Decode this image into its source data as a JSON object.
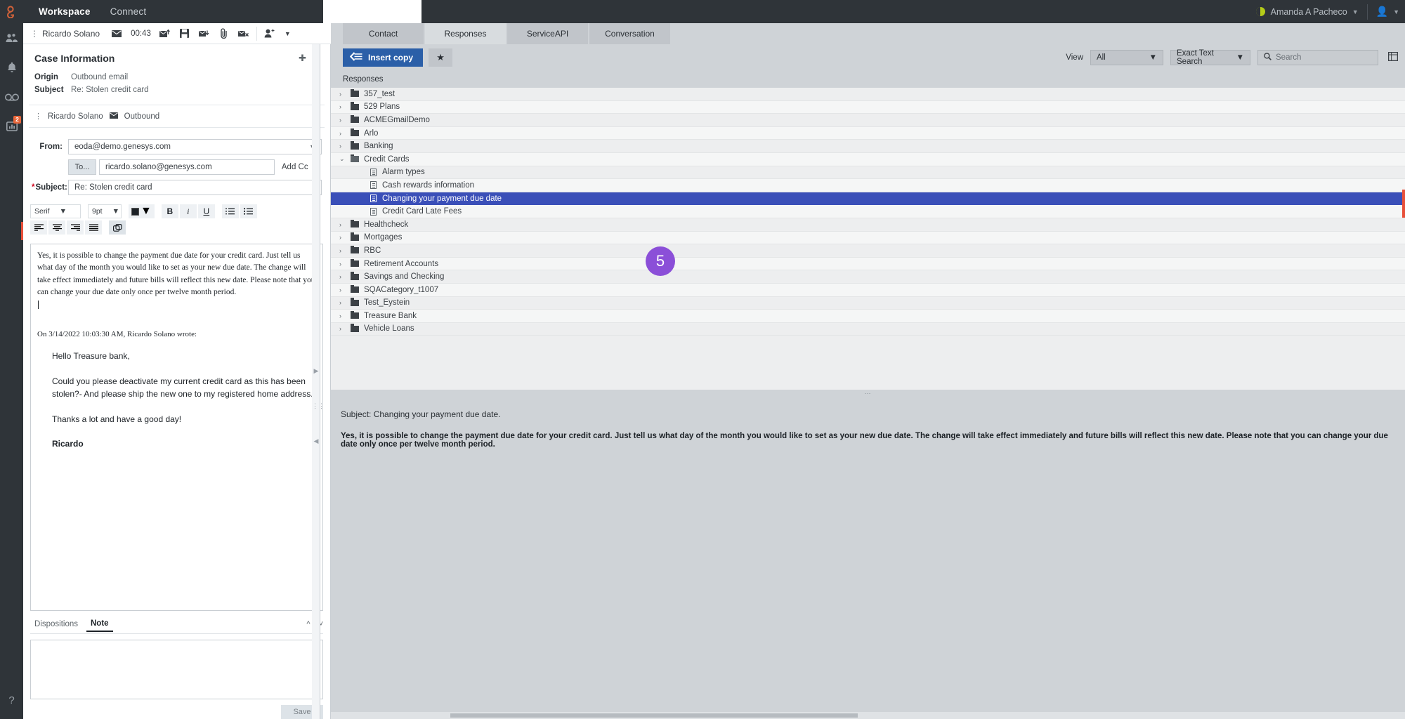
{
  "topbar": {
    "logo": "genesys-logo",
    "nav": [
      {
        "label": "Workspace",
        "active": true
      },
      {
        "label": "Connect",
        "active": false
      }
    ],
    "user_name": "Amanda A Pacheco",
    "status_icon": "half-circle-status-icon",
    "status_color": "#b5cc18",
    "agent_icon": "person-icon"
  },
  "rail": {
    "items": [
      {
        "name": "contacts-icon"
      },
      {
        "name": "notifications-bell-icon"
      },
      {
        "name": "voicemail-icon"
      },
      {
        "name": "dashboard-icon",
        "badge": "2"
      }
    ],
    "help_label": "?"
  },
  "case_toolbar": {
    "party": "Ricardo Solano",
    "timer": "00:43",
    "icons": [
      "email-icon",
      "reply-send-icon",
      "save-icon",
      "transfer-icon",
      "attachment-icon",
      "delete-email-icon",
      "consult-person-icon"
    ]
  },
  "case_info": {
    "title": "Case Information",
    "add_icon": "plus-icon",
    "collapse_icon": "chevron-up-icon",
    "fields": [
      {
        "key": "Origin",
        "value": "Outbound email"
      },
      {
        "key": "Subject",
        "value": "Re: Stolen credit card"
      }
    ],
    "party_row": {
      "name": "Ricardo Solano",
      "direction": "Outbound",
      "icon": "email-icon"
    }
  },
  "compose": {
    "from_label": "From:",
    "from_value": "eoda@demo.genesys.com",
    "to_label": "To...",
    "to_value": "ricardo.solano@genesys.com",
    "add_cc_label": "Add Cc",
    "subject_label": "Subject:",
    "subject_value": "Re: Stolen credit card",
    "toolbar": {
      "font_family": "Serif",
      "font_size": "9pt",
      "bold": "B",
      "italic": "i",
      "underline": "U",
      "color_icon": "text-color-icon",
      "ordered_list_icon": "numbered-list-icon",
      "unordered_list_icon": "bullet-list-icon",
      "align_left_icon": "align-left-icon",
      "align_center_icon": "align-center-icon",
      "align_right_icon": "align-right-icon",
      "align_justify_icon": "align-justify-icon",
      "insert_image_icon": "insert-image-icon"
    },
    "reply_text": "Yes, it is possible to change the payment due date for your credit card.  Just tell us what day of the month you would like to set as your new due date.  The change will take effect immediately and future bills will reflect this new date.  Please note that you can change your due date only once per twelve month period.",
    "quote_header": "On 3/14/2022 10:03:30 AM, Ricardo Solano wrote:",
    "quoted": [
      "Hello Treasure bank,",
      "Could you please deactivate my current credit card as this has been stolen?- And please ship the new one to my registered home address.",
      "Thanks a lot and have a good day!"
    ],
    "quoted_signature": "Ricardo"
  },
  "bottom_tabs": {
    "tabs": [
      {
        "label": "Dispositions",
        "active": false
      },
      {
        "label": "Note",
        "active": true
      }
    ],
    "collapse_up_icon": "chevron-up-icon",
    "collapse_down_icon": "chevron-down-icon",
    "note_value": "",
    "save_label": "Save"
  },
  "right": {
    "tabs": [
      {
        "label": "Contact",
        "active": false
      },
      {
        "label": "Responses",
        "active": true
      },
      {
        "label": "ServiceAPI",
        "active": false
      },
      {
        "label": "Conversation",
        "active": false
      }
    ],
    "insert_copy_label": "Insert copy",
    "insert_copy_icon": "insert-arrow-icon",
    "favorite_icon": "star-add-icon",
    "view_label": "View",
    "view_value": "All",
    "search_mode_value": "Exact Text Search",
    "search_placeholder": "Search",
    "search_icon": "search-icon",
    "grid_icon": "grid-view-icon",
    "responses_label": "Responses",
    "step_badge": "5",
    "tree": [
      {
        "label": "357_test",
        "type": "folder",
        "level": 1,
        "expanded": false
      },
      {
        "label": "529 Plans",
        "type": "folder",
        "level": 1,
        "expanded": false
      },
      {
        "label": "ACMEGmailDemo",
        "type": "folder",
        "level": 1,
        "expanded": false
      },
      {
        "label": "Arlo",
        "type": "folder",
        "level": 1,
        "expanded": false
      },
      {
        "label": "Banking",
        "type": "folder",
        "level": 1,
        "expanded": false
      },
      {
        "label": "Credit Cards",
        "type": "folder",
        "level": 1,
        "expanded": true
      },
      {
        "label": "Alarm types",
        "type": "document",
        "level": 2
      },
      {
        "label": "Cash rewards information",
        "type": "document",
        "level": 2
      },
      {
        "label": "Changing your payment due date",
        "type": "document",
        "level": 2,
        "selected": true
      },
      {
        "label": "Credit Card Late Fees",
        "type": "document",
        "level": 2
      },
      {
        "label": "Healthcheck",
        "type": "folder",
        "level": 1,
        "expanded": false
      },
      {
        "label": "Mortgages",
        "type": "folder",
        "level": 1,
        "expanded": false
      },
      {
        "label": "RBC",
        "type": "folder",
        "level": 1,
        "expanded": false
      },
      {
        "label": "Retirement Accounts",
        "type": "folder",
        "level": 1,
        "expanded": false
      },
      {
        "label": "Savings and Checking",
        "type": "folder",
        "level": 1,
        "expanded": false
      },
      {
        "label": "SQACategory_t1007",
        "type": "folder",
        "level": 1,
        "expanded": false
      },
      {
        "label": "Test_Eystein",
        "type": "folder",
        "level": 1,
        "expanded": false
      },
      {
        "label": "Treasure Bank",
        "type": "folder",
        "level": 1,
        "expanded": false
      },
      {
        "label": "Vehicle Loans",
        "type": "folder",
        "level": 1,
        "expanded": false
      }
    ],
    "preview": {
      "subject": "Subject: Changing your payment due date.",
      "body": "Yes, it is possible to change the payment due date for your credit card.  Just tell us what day of the month you would like to set as your new due date.  The change will take effect immediately and future bills will reflect this new date.  Please note that you can change your due date only once per twelve month period."
    }
  }
}
